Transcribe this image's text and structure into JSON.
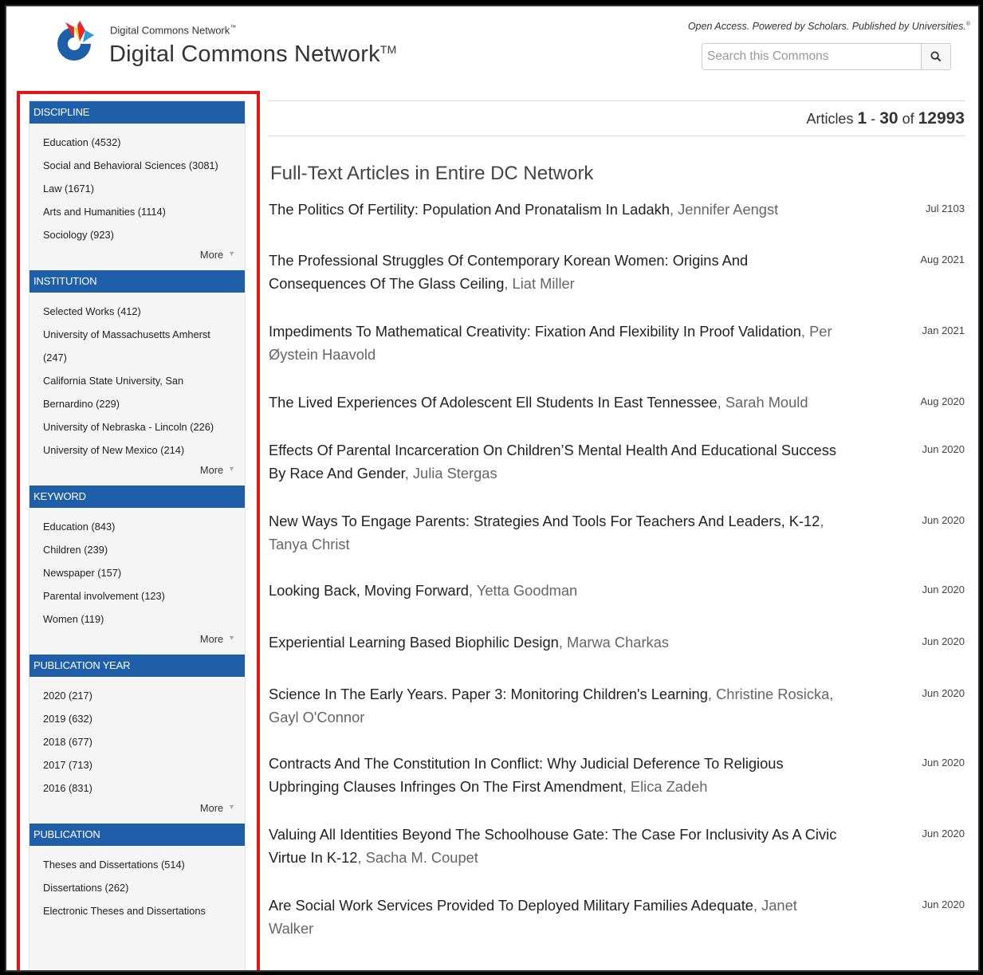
{
  "header": {
    "brand_small": "Digital Commons Network",
    "brand_small_tm": "™",
    "brand_big": "Digital Commons Network",
    "brand_big_tm": "TM",
    "tagline": "Open Access. Powered by Scholars. Published by Universities.",
    "tagline_mark": "®",
    "search_placeholder": "Search this Commons",
    "search_value": ""
  },
  "sidebar": {
    "more_label": "More",
    "facets": [
      {
        "heading": "DISCIPLINE",
        "items": [
          "Education (4532)",
          "Social and Behavioral Sciences (3081)",
          "Law (1671)",
          "Arts and Humanities (1114)",
          "Sociology (923)"
        ]
      },
      {
        "heading": "INSTITUTION",
        "items": [
          "Selected Works (412)",
          "University of Massachusetts Amherst (247)",
          "California State University, San Bernardino (229)",
          "University of Nebraska - Lincoln (226)",
          "University of New Mexico (214)"
        ]
      },
      {
        "heading": "KEYWORD",
        "items": [
          "Education (843)",
          "Children (239)",
          "Newspaper (157)",
          "Parental involvement (123)",
          "Women (119)"
        ]
      },
      {
        "heading": "PUBLICATION YEAR",
        "items": [
          "2020 (217)",
          "2019 (632)",
          "2018 (677)",
          "2017 (713)",
          "2016 (831)"
        ]
      },
      {
        "heading": "PUBLICATION",
        "items": [
          "Theses and Dissertations (514)",
          "Dissertations (262)",
          "Electronic Theses and Dissertations"
        ]
      }
    ]
  },
  "main": {
    "count_prefix": "Articles",
    "count_start": "1",
    "count_sep": "-",
    "count_end": "30",
    "count_of": "of",
    "count_total": "12993",
    "section_title": "Full-Text Articles in Entire DC Network",
    "articles": [
      {
        "title": "The Politics Of Fertility: Population And Pronatalism In Ladakh",
        "author": "Jennifer Aengst",
        "date": "Jul 2103"
      },
      {
        "title": "The Professional Struggles Of Contemporary Korean Women: Origins And Consequences Of The Glass Ceiling",
        "author": "Liat Miller",
        "date": "Aug 2021"
      },
      {
        "title": "Impediments To Mathematical Creativity: Fixation And Flexibility In Proof Validation",
        "author": "Per Øystein Haavold",
        "date": "Jan 2021"
      },
      {
        "title": "The Lived Experiences Of Adolescent Ell Students In East Tennessee",
        "author": "Sarah Mould",
        "date": "Aug 2020"
      },
      {
        "title": "Effects Of Parental Incarceration On Children’S Mental Health And Educational Success By Race And Gender",
        "author": "Julia Stergas",
        "date": "Jun 2020"
      },
      {
        "title": "New Ways To Engage Parents: Strategies And Tools For Teachers And Leaders, K-12",
        "author": "Tanya Christ",
        "date": "Jun 2020"
      },
      {
        "title": "Looking Back, Moving Forward",
        "author": "Yetta Goodman",
        "date": "Jun 2020"
      },
      {
        "title": "Experiential Learning Based Biophilic Design",
        "author": "Marwa Charkas",
        "date": "Jun 2020"
      },
      {
        "title": "Science In The Early Years. Paper 3: Monitoring Children's Learning",
        "author": "Christine Rosicka, Gayl O'Connor",
        "date": "Jun 2020"
      },
      {
        "title": "Contracts And The Constitution In Conflict: Why Judicial Deference To Religious Upbringing Clauses Infringes On The First Amendment",
        "author": "Elica Zadeh",
        "date": "Jun 2020"
      },
      {
        "title": "Valuing All Identities Beyond The Schoolhouse Gate: The Case For Inclusivity As A Civic Virtue In K-12",
        "author": "Sacha M. Coupet",
        "date": "Jun 2020"
      },
      {
        "title": "Are Social Work Services Provided To Deployed Military Families Adequate",
        "author": "Janet Walker",
        "date": "Jun 2020"
      }
    ]
  },
  "icons": {
    "search": "search-icon",
    "logo": "digital-commons-logo"
  },
  "colors": {
    "facet_header": "#1f5ea8",
    "highlight": "#e0161b"
  }
}
